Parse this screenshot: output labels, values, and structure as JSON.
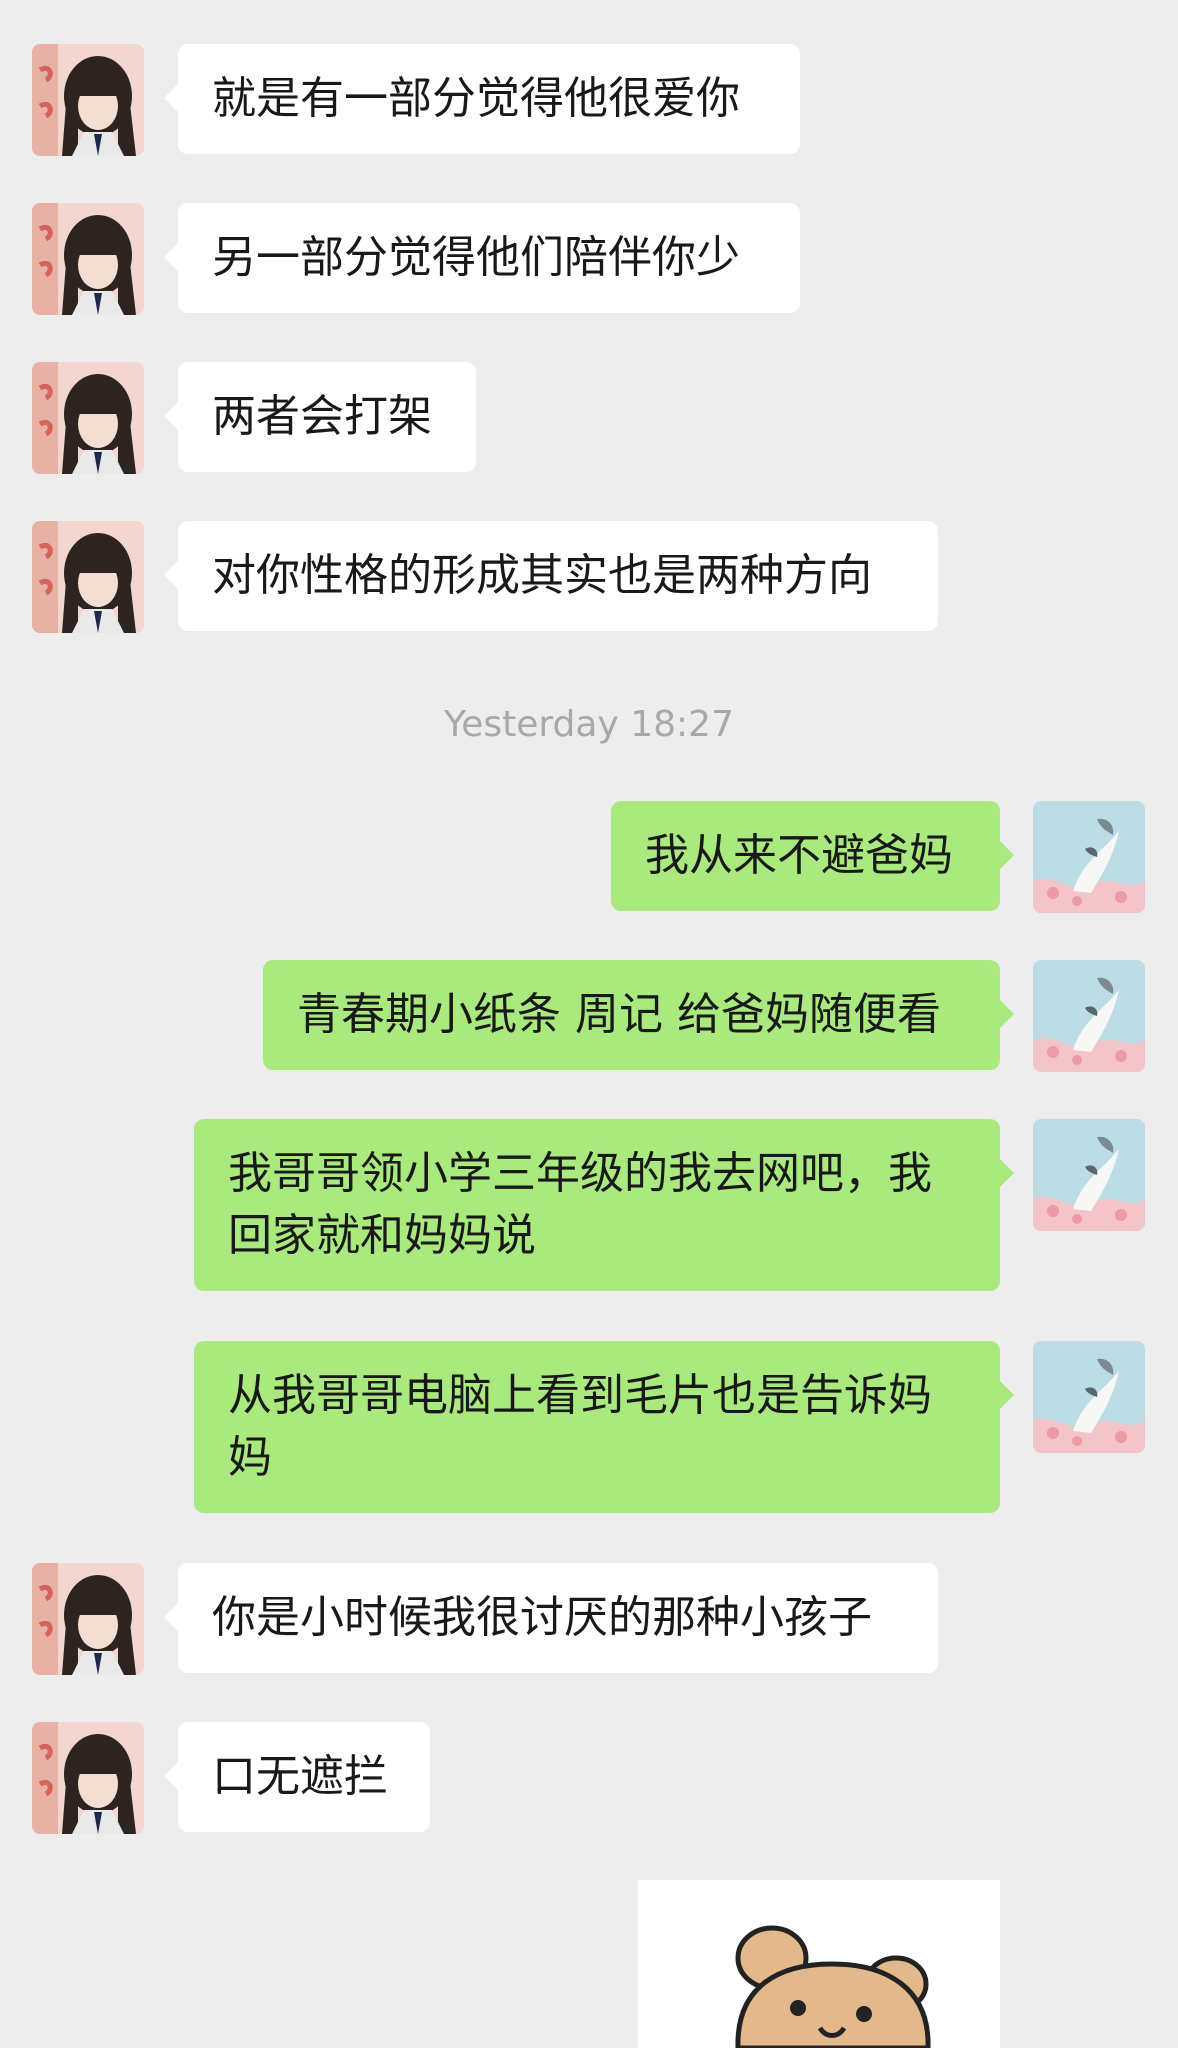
{
  "chat": {
    "timestamp": "Yesterday 18:27",
    "messages": [
      {
        "side": "in",
        "text": "就是有一部分觉得他很爱你"
      },
      {
        "side": "in",
        "text": "另一部分觉得他们陪伴你少"
      },
      {
        "side": "in",
        "text": "两者会打架"
      },
      {
        "side": "in",
        "text": "对你性格的形成其实也是两种方向"
      },
      {
        "side": "out",
        "text": "我从来不避爸妈"
      },
      {
        "side": "out",
        "text": "青春期小纸条 周记 给爸妈随便看"
      },
      {
        "side": "out",
        "text": "我哥哥领小学三年级的我去网吧，我回家就和妈妈说"
      },
      {
        "side": "out",
        "text": "从我哥哥电脑上看到毛片也是告诉妈妈"
      },
      {
        "side": "in",
        "text": "你是小时候我很讨厌的那种小孩子"
      },
      {
        "side": "in",
        "text": "口无遮拦"
      }
    ],
    "sticker": {
      "icon": "bear-sticker-icon"
    }
  }
}
